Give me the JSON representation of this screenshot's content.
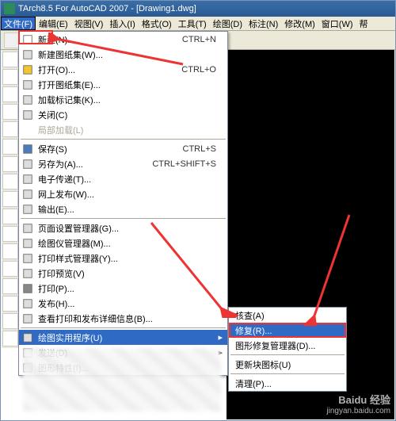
{
  "title": "TArch8.5 For AutoCAD 2007 - [Drawing1.dwg]",
  "menubar": [
    "文件(F)",
    "编辑(E)",
    "视图(V)",
    "插入(I)",
    "格式(O)",
    "工具(T)",
    "绘图(D)",
    "标注(N)",
    "修改(M)",
    "窗口(W)",
    "帮"
  ],
  "file_menu": {
    "g1": [
      {
        "label": "新建(N)...",
        "shortcut": "CTRL+N",
        "icon": "new"
      },
      {
        "label": "新建图纸集(W)...",
        "icon": "sheetset"
      },
      {
        "label": "打开(O)...",
        "shortcut": "CTRL+O",
        "icon": "open"
      },
      {
        "label": "打开图纸集(E)...",
        "icon": "open-sheet"
      },
      {
        "label": "加载标记集(K)...",
        "icon": "load"
      },
      {
        "label": "关闭(C)",
        "icon": "close"
      },
      {
        "label": "局部加载(L)",
        "disabled": true
      }
    ],
    "g2": [
      {
        "label": "保存(S)",
        "shortcut": "CTRL+S",
        "icon": "save"
      },
      {
        "label": "另存为(A)...",
        "shortcut": "CTRL+SHIFT+S",
        "icon": "saveas"
      },
      {
        "label": "电子传递(T)...",
        "icon": "etransmit"
      },
      {
        "label": "网上发布(W)...",
        "icon": "web"
      },
      {
        "label": "输出(E)...",
        "icon": "export"
      }
    ],
    "g3": [
      {
        "label": "页面设置管理器(G)...",
        "icon": "page"
      },
      {
        "label": "绘图仪管理器(M)...",
        "icon": "plotter"
      },
      {
        "label": "打印样式管理器(Y)...",
        "icon": "style"
      },
      {
        "label": "打印预览(V)",
        "icon": "preview"
      },
      {
        "label": "打印(P)...",
        "icon": "print"
      },
      {
        "label": "发布(H)...",
        "icon": "publish"
      },
      {
        "label": "查看打印和发布详细信息(B)...",
        "icon": "details"
      }
    ],
    "g4": [
      {
        "label": "绘图实用程序(U)",
        "submenu": true,
        "highlight": true,
        "icon": "utils"
      },
      {
        "label": "发送(D)",
        "submenu": true,
        "icon": "send"
      },
      {
        "label": "图形特性(I)...",
        "icon": "props"
      }
    ]
  },
  "submenu_items": [
    {
      "label": "核查(A)"
    },
    {
      "label": "修复(R)...",
      "selected": true
    },
    {
      "label": "图形修复管理器(D)..."
    },
    {
      "sep": true
    },
    {
      "label": "更新块图标(U)"
    },
    {
      "sep": true
    },
    {
      "label": "清理(P)..."
    }
  ],
  "watermark": {
    "brand": "Baidu 经验",
    "url": "jingyan.baidu.com"
  }
}
